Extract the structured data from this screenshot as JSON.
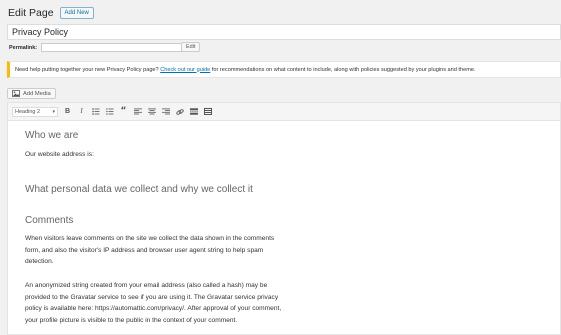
{
  "header": {
    "title": "Edit Page",
    "add_new_label": "Add New"
  },
  "post": {
    "title": "Privacy Policy"
  },
  "permalink": {
    "label": "Permalink:",
    "edit_label": "Edit"
  },
  "notice": {
    "text_before": "Need help putting together your new Privacy Policy page? ",
    "link_text": "Check out our guide",
    "text_after": " for recommendations on what content to include, along with policies suggested by your plugins and theme."
  },
  "media": {
    "add_media_label": "Add Media"
  },
  "toolbar": {
    "format_value": "Heading 2",
    "icons": [
      "bold-icon",
      "italic-icon",
      "bulleted-list-icon",
      "numbered-list-icon",
      "blockquote-icon",
      "align-left-icon",
      "align-center-icon",
      "align-right-icon",
      "insert-link-icon",
      "read-more-icon",
      "toolbar-toggle-icon"
    ]
  },
  "content": {
    "heading_1": "Who we are",
    "para_1": "Our website address is:",
    "heading_2": "What personal data we collect and why we collect it",
    "heading_3": "Comments",
    "para_2": "When visitors leave comments on the site we collect the data shown in the comments form, and also the visitor's IP address and browser user agent string to help spam detection.",
    "para_3": "An anonymized string created from your email address (also called a hash) may be provided to the Gravatar service to see if you are using it. The Gravatar service privacy policy is available here: https://automattic.com/privacy/. After approval of your comment, your profile picture is visible to the public in the context of your comment."
  },
  "colors": {
    "link": "#0073aa",
    "notice_border": "#ffb900"
  }
}
